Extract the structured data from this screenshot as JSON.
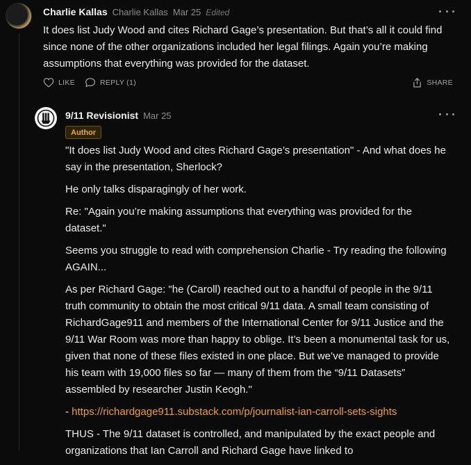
{
  "comment1": {
    "author": "Charlie Kallas",
    "handle": "Charlie Kallas",
    "date": "Mar 25",
    "edited": "Edited",
    "text_lines": [
      "It does list Judy Wood and cites Richard Gage’s presentation. But that’s all it could find",
      "since none of the other organizations included her legal filings. Again you’re making",
      "assumptions that everything was provided for the dataset."
    ],
    "actions": {
      "like": "LIKE",
      "reply": "REPLY (1)",
      "share": "SHARE"
    }
  },
  "comment2": {
    "author": "9/11 Revisionist",
    "date": "Mar 25",
    "badge": "Author",
    "paragraphs": [
      [
        "\"It does list Judy Wood and cites Richard Gage’s presentation\" - And what does he",
        "say in the presentation, Sherlock?"
      ],
      [
        "He only talks disparagingly of her work."
      ],
      [
        "Re: \"Again you’re making assumptions that everything was provided for the",
        "dataset.\""
      ],
      [
        "Seems you struggle to read with comprehension Charlie - Try reading the following",
        "AGAIN..."
      ],
      [
        "As per Richard Gage: \"he (Caroll) reached out to a handful of people in the 9/11",
        "truth community to obtain the most critical 9/11 data. A small team consisting of",
        "RichardGage911 and members of the International Center for 9/11 Justice and the",
        "9/11 War Room was more than happy to oblige. It’s been a monumental task for us,",
        "given that none of these files existed in one place. But we’ve managed to provide",
        "his team with 19,000 files so far — many of them from the “9/11 Datasets”",
        "assembled by researcher Justin Keogh.\""
      ]
    ],
    "link_prefix": "- ",
    "link_text": "https://richardgage911.substack.com/p/journalist-ian-carroll-sets-sights",
    "last_paragraph": [
      "THUS - The 9/11 dataset is controlled, and manipulated by the exact people and",
      "organizations that Ian Carroll and Richard Gage have linked to"
    ]
  }
}
